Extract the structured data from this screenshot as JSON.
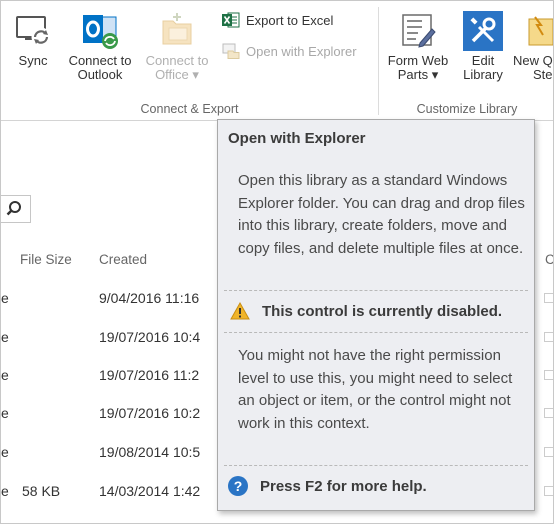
{
  "ribbon": {
    "connect_export": {
      "label": "Connect & Export",
      "sync": {
        "label": "Sync",
        "icon": "sync-icon"
      },
      "connect_outlook": {
        "label_line1": "Connect to",
        "label_line2": "Outlook",
        "icon": "outlook-icon"
      },
      "connect_office": {
        "label_line1": "Connect to",
        "label_line2": "Office ▾",
        "icon": "office-icon",
        "disabled": true
      },
      "export_excel": {
        "label": "Export to Excel",
        "icon": "excel-icon"
      },
      "open_explorer": {
        "label": "Open with Explorer",
        "icon": "explorer-icon",
        "disabled": true
      }
    },
    "customize_library": {
      "label": "Customize Library",
      "form_web_parts": {
        "label_line1": "Form Web",
        "label_line2": "Parts ▾",
        "icon": "form-web-parts-icon"
      },
      "edit_library": {
        "label_line1": "Edit",
        "label_line2": "Library",
        "icon": "edit-library-icon"
      },
      "new_quick_step": {
        "label_line1": "New Q",
        "label_line2": "Ste",
        "icon": "new-quick-step-icon"
      }
    }
  },
  "list": {
    "columns": [
      "File Size",
      "Created"
    ],
    "rows": [
      {
        "name_tail": "e",
        "size": "",
        "created": "9/04/2016 11:16"
      },
      {
        "name_tail": "e",
        "size": "",
        "created": "19/07/2016 10:4"
      },
      {
        "name_tail": "e",
        "size": "",
        "created": "19/07/2016 11:2"
      },
      {
        "name_tail": "e",
        "size": "",
        "created": "19/07/2016 10:2"
      },
      {
        "name_tail": "e",
        "size": "",
        "created": "19/08/2014 10:5"
      },
      {
        "name_tail": "e",
        "size": "58 KB",
        "created": "14/03/2014 1:42"
      }
    ],
    "right_header_fragment": "C"
  },
  "tooltip": {
    "title": "Open with Explorer",
    "description": "Open this library as a standard Windows Explorer folder. You can drag and drop files into this library, create folders, move and copy files, and delete multiple files at once.",
    "warning": "This control is currently disabled.",
    "reason": "You might not have the right permission level to use this, you might need to select an object or item, or the control might not work in this context.",
    "help": "Press F2 for more help.",
    "help_glyph": "?"
  },
  "colors": {
    "tooltip_bg": "#edeef2",
    "outlook_blue": "#0072c6",
    "excel_green": "#1e7145",
    "edit_library_blue": "#2a74c5",
    "warning_yellow": "#f0b42a"
  }
}
